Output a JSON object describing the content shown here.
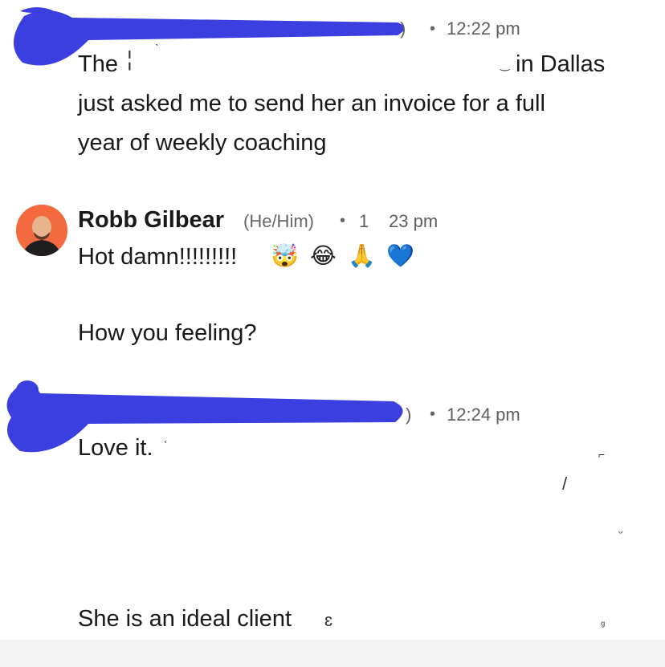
{
  "messages": [
    {
      "time": "12:22 pm",
      "meta_prefix": ")",
      "lines": [
        "The",
        "in Dallas",
        "just asked me to send her an invoice for a full",
        "year of weekly coaching"
      ]
    },
    {
      "author": "Robb Gilbear",
      "pronouns": "(He/Him)",
      "time_part1": "1",
      "time_part2": "23 pm",
      "line1": "Hot damn!!!!!!!!!",
      "emoji": [
        "🤯",
        "😂",
        "🙏",
        "💙"
      ],
      "line2": "How you feeling?"
    },
    {
      "time": "12:24 pm",
      "meta_prefix": ")",
      "line1": "Love it.",
      "line_last": "She is an ideal client"
    }
  ],
  "colors": {
    "redaction": "#3b3fe0",
    "avatar_bg": "#f26a3d"
  }
}
